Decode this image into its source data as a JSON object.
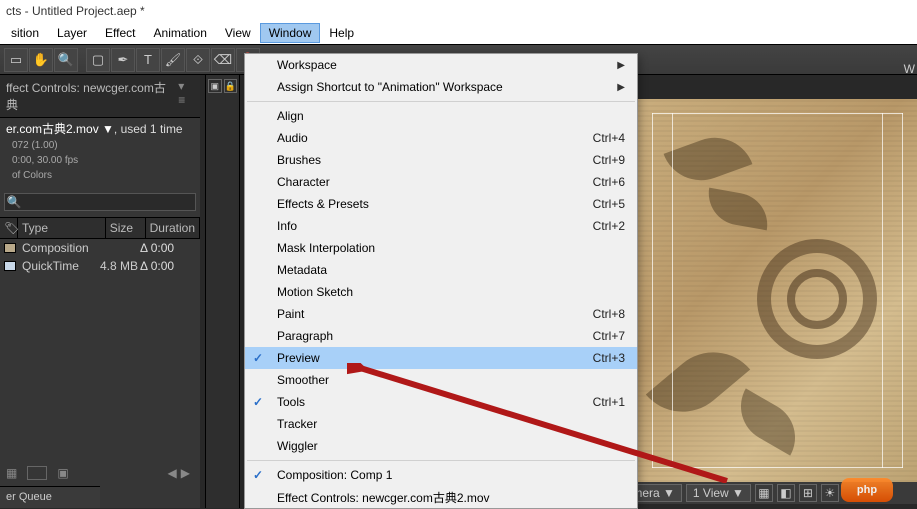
{
  "title": "cts - Untitled Project.aep *",
  "menus": {
    "composition": "sition",
    "layer": "Layer",
    "effect": "Effect",
    "animation": "Animation",
    "view": "View",
    "window": "Window",
    "help": "Help"
  },
  "panel_tab": "ffect Controls: newcger.com古典",
  "project": {
    "name": "er.com古典2.mov ▼",
    "used": ", used 1 time",
    "meta1": "072 (1.00)",
    "meta2": "0:00, 30.00 fps",
    "meta3": "of Colors"
  },
  "cols": {
    "type": "Type",
    "size": "Size",
    "duration": "Duration"
  },
  "rows": [
    {
      "name": "Composition",
      "size": "",
      "dur": "Δ 0:00",
      "cls": ""
    },
    {
      "name": "QuickTime",
      "size": "4.8 MB",
      "dur": "Δ 0:00",
      "cls": "mov"
    }
  ],
  "render_queue": "er Queue",
  "dropdown": [
    {
      "label": "Workspace",
      "arrow": true
    },
    {
      "label": "Assign Shortcut to \"Animation\" Workspace",
      "arrow": true
    },
    {
      "sep": true
    },
    {
      "label": "Align"
    },
    {
      "label": "Audio",
      "shortcut": "Ctrl+4"
    },
    {
      "label": "Brushes",
      "shortcut": "Ctrl+9"
    },
    {
      "label": "Character",
      "shortcut": "Ctrl+6"
    },
    {
      "label": "Effects & Presets",
      "shortcut": "Ctrl+5"
    },
    {
      "label": "Info",
      "shortcut": "Ctrl+2"
    },
    {
      "label": "Mask Interpolation"
    },
    {
      "label": "Metadata"
    },
    {
      "label": "Motion Sketch"
    },
    {
      "label": "Paint",
      "shortcut": "Ctrl+8"
    },
    {
      "label": "Paragraph",
      "shortcut": "Ctrl+7"
    },
    {
      "label": "Preview",
      "shortcut": "Ctrl+3",
      "checked": true,
      "highlight": true
    },
    {
      "label": "Smoother"
    },
    {
      "label": "Tools",
      "shortcut": "Ctrl+1",
      "checked": true
    },
    {
      "label": "Tracker"
    },
    {
      "label": "Wiggler"
    },
    {
      "sep": true
    },
    {
      "label": "Composition: Comp 1",
      "checked": true
    },
    {
      "label": "Effect Controls: newcger.com古典2.mov"
    }
  ],
  "viewer_bar": {
    "camera": "e Camera ▼",
    "view": "1 View ▼"
  },
  "watermark": "php",
  "w_label": "W"
}
